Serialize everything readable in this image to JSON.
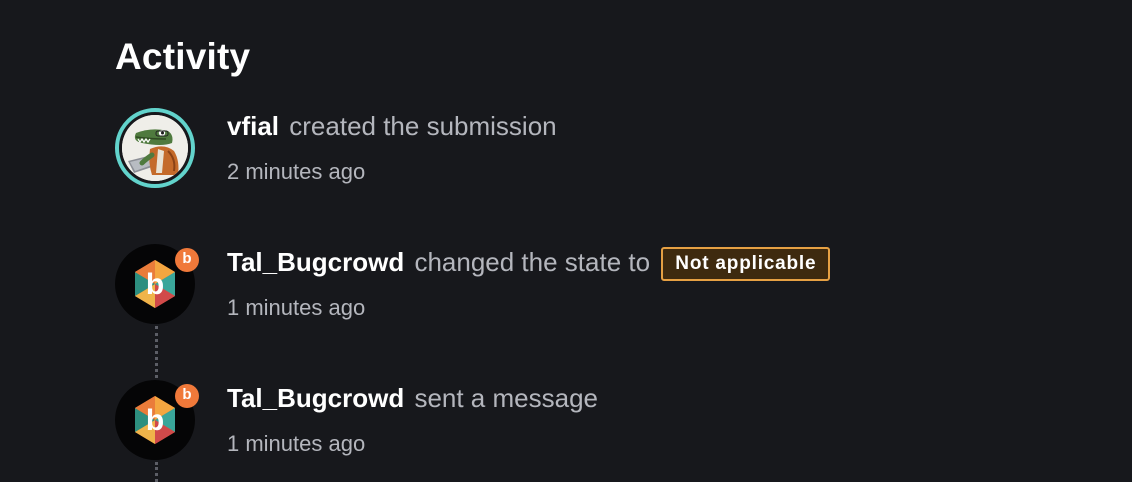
{
  "heading": "Activity",
  "entries": [
    {
      "user": "vfial",
      "action": "created the submission",
      "time": "2 minutes ago",
      "avatar": "user-avatar"
    },
    {
      "user": "Tal_Bugcrowd",
      "action": "changed the state to",
      "state": "Not applicable",
      "time": "1 minutes ago",
      "avatar": "bugcrowd-logo",
      "badge": "b"
    },
    {
      "user": "Tal_Bugcrowd",
      "action": "sent a message",
      "time": "1 minutes ago",
      "avatar": "bugcrowd-logo",
      "badge": "b"
    }
  ],
  "colors": {
    "background": "#17181c",
    "avatar_ring": "#62d3cc",
    "badge": "#f0793a",
    "state_border": "#e6a043",
    "state_fill": "#3e2a0f"
  }
}
